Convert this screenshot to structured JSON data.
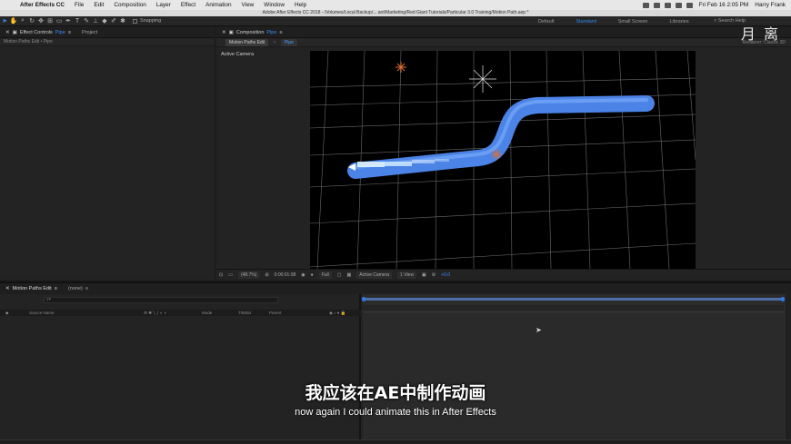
{
  "menubar": {
    "app": "After Effects CC",
    "items": [
      "File",
      "Edit",
      "Composition",
      "Layer",
      "Effect",
      "Animation",
      "View",
      "Window",
      "Help"
    ],
    "clock": "Fri Feb 16  2:05 PM",
    "user": "Harry Frank"
  },
  "window_title": "Adobe After Effects CC 2018 - /Volumes/Local Backup/... ant/Marketing/Red Giant Tutorials/Particular 3.0 Training/Motion Path.aep *",
  "toolbar": {
    "snapping": "Snapping",
    "workspaces": [
      "Default",
      "Standard",
      "Small Screen",
      "Libraries"
    ],
    "selected_workspace": "Standard",
    "search_help": "Search Help"
  },
  "effect_controls": {
    "tab_label": "Effect Controls",
    "tab_layer": "Pipe",
    "project_tab": "Project",
    "subheader": "Motion Paths Edit • Pipe"
  },
  "composition": {
    "tab_label": "Composition",
    "tab_comp": "Pipe",
    "breadcrumb_1": "Motion Paths Edit",
    "breadcrumb_2": "Pipe",
    "view_label": "Active Camera",
    "footer": {
      "zoom": "(48.7%)",
      "timecode": "0:00:01:08",
      "resolution": "Full",
      "camera": "Active Camera",
      "views": "1 View",
      "offset": "+0.0"
    }
  },
  "watermark": {
    "logo": "月 离",
    "renderer": "Renderer:",
    "renderer_value": "Classic 3D"
  },
  "timeline": {
    "tabs": [
      "Motion Paths Edit",
      "(none)"
    ],
    "search_placeholder": "⌕▾",
    "columns": [
      "Source Name",
      "Mode",
      "TrkMat",
      "Parent"
    ]
  },
  "subtitles": {
    "chinese": "我应该在AE中制作动画",
    "english": "now again I could animate this in After Effects"
  },
  "colors": {
    "accent_blue": "#2d8ceb",
    "pipe_blue": "#4a86e8",
    "viewport_bg": "#000000"
  }
}
